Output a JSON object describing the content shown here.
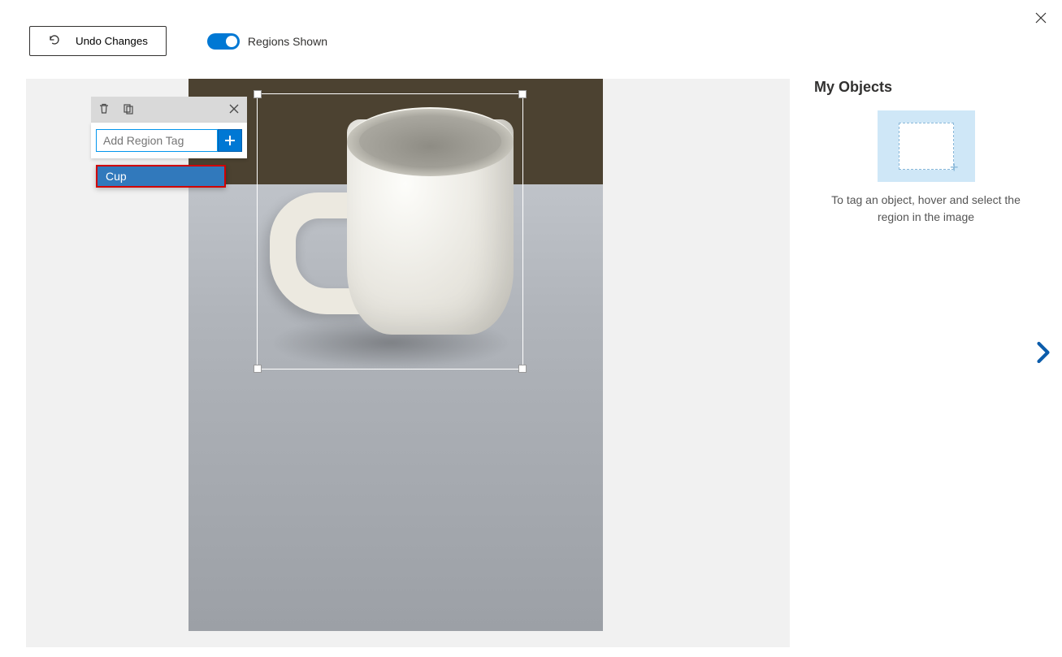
{
  "toolbar": {
    "undo_label": "Undo Changes",
    "regions_label": "Regions Shown"
  },
  "tag_panel": {
    "input_placeholder": "Add Region Tag",
    "suggestion": "Cup"
  },
  "sidebar": {
    "title": "My Objects",
    "hint": "To tag an object, hover and select the region in the image"
  }
}
